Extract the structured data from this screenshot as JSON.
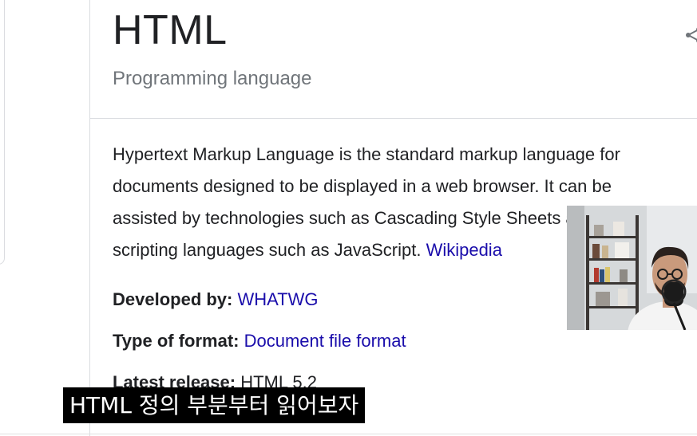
{
  "panel": {
    "title": "HTML",
    "subtitle": "Programming language",
    "description": {
      "lines": [
        "Hypertext Markup Language is the standard markup language for",
        "documents designed to be displayed in a web browser. It can be",
        "assisted by technologies such as Cascading Style Sheets and",
        "scripting languages such as JavaScript."
      ],
      "source_link": "Wikipedia"
    },
    "facts": [
      {
        "label": "Developed by:",
        "value": "WHATWG",
        "is_link": true
      },
      {
        "label": "Type of format:",
        "value": "Document file format",
        "is_link": true
      },
      {
        "label": "Latest release:",
        "value": "HTML 5.2",
        "is_link": false
      }
    ]
  },
  "caption": {
    "text": "HTML 정의 부분부터 읽어보자"
  },
  "colors": {
    "link": "#1a0dab",
    "text": "#202124",
    "muted": "#70757a",
    "border": "#dadce0"
  }
}
